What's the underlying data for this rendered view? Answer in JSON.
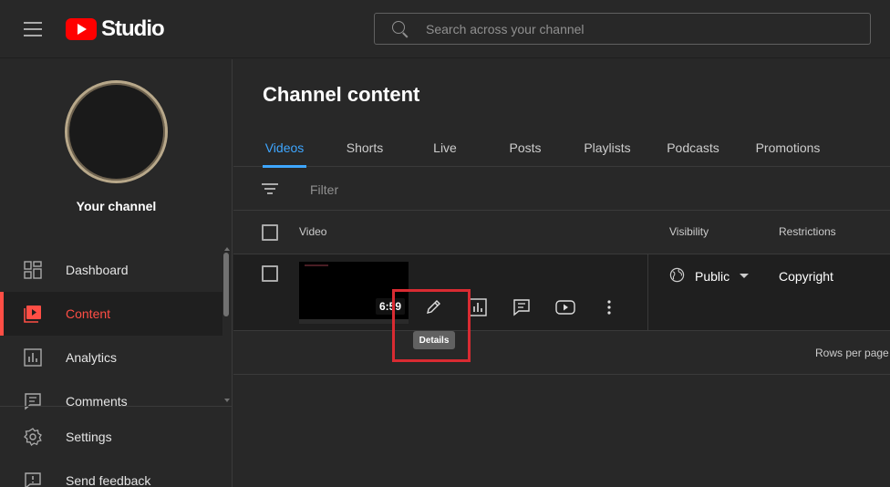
{
  "header": {
    "logo_text": "Studio",
    "search_placeholder": "Search across your channel"
  },
  "sidebar": {
    "channel_label": "Your channel",
    "items": [
      {
        "label": "Dashboard",
        "icon": "dashboard-icon",
        "active": false
      },
      {
        "label": "Content",
        "icon": "content-icon",
        "active": true
      },
      {
        "label": "Analytics",
        "icon": "analytics-icon",
        "active": false
      },
      {
        "label": "Comments",
        "icon": "comments-icon",
        "active": false
      }
    ],
    "bottom_items": [
      {
        "label": "Settings",
        "icon": "gear-icon"
      },
      {
        "label": "Send feedback",
        "icon": "feedback-icon"
      }
    ]
  },
  "main": {
    "title": "Channel content",
    "tabs": [
      "Videos",
      "Shorts",
      "Live",
      "Posts",
      "Playlists",
      "Podcasts",
      "Promotions"
    ],
    "active_tab": "Videos",
    "filter_placeholder": "Filter",
    "columns": {
      "video": "Video",
      "visibility": "Visibility",
      "restrictions": "Restrictions"
    },
    "rows": [
      {
        "duration": "6:59",
        "visibility": "Public",
        "restrictions": "Copyright"
      }
    ],
    "tooltip": "Details",
    "rows_per_page_label": "Rows per page"
  },
  "colors": {
    "accent_red": "#ff4e45",
    "tab_blue": "#3ea6ff",
    "highlight": "#d92b32",
    "brand_red": "#ff0000"
  }
}
